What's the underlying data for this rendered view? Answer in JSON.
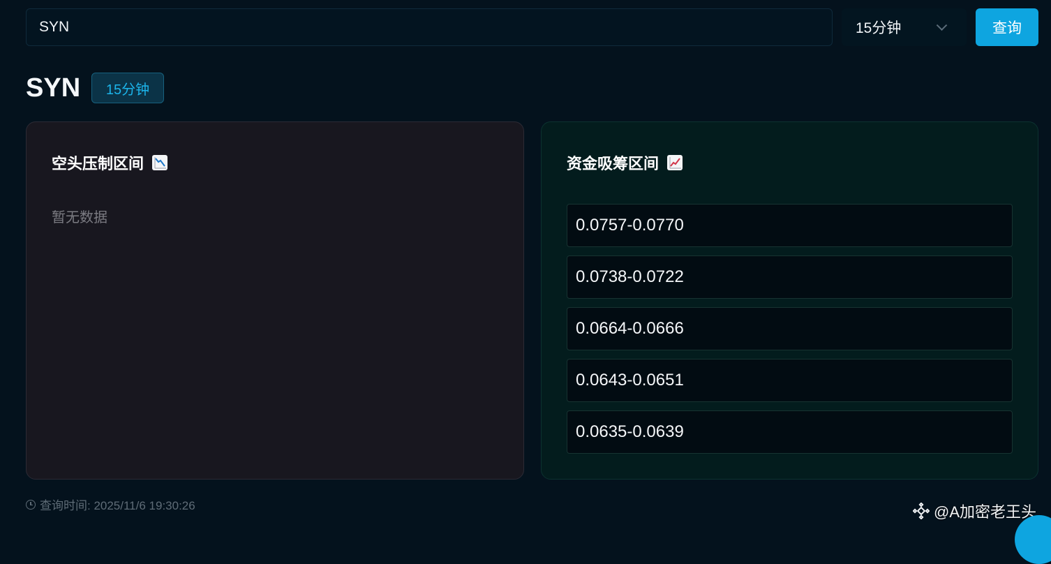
{
  "search": {
    "value": "SYN"
  },
  "interval_select": {
    "selected": "15分钟"
  },
  "query_button": {
    "label": "查询"
  },
  "header": {
    "symbol": "SYN",
    "interval_badge": "15分钟"
  },
  "bear_panel": {
    "title": "空头压制区间",
    "icon": "chart-decreasing-icon",
    "empty_text": "暂无数据"
  },
  "accumulation_panel": {
    "title": "资金吸筹区间",
    "icon": "chart-increasing-icon",
    "ranges": [
      "0.0757-0.0770",
      "0.0738-0.0722",
      "0.0664-0.0666",
      "0.0643-0.0651",
      "0.0635-0.0639"
    ]
  },
  "footer": {
    "query_time": "查询时间: 2025/11/6 19:30:26"
  },
  "watermark": {
    "text": "@A加密老王头"
  },
  "colors": {
    "accent": "#0ea5e0",
    "background": "#04121d",
    "bear_panel": "#18171f",
    "accumulation_panel": "#031c1d"
  }
}
